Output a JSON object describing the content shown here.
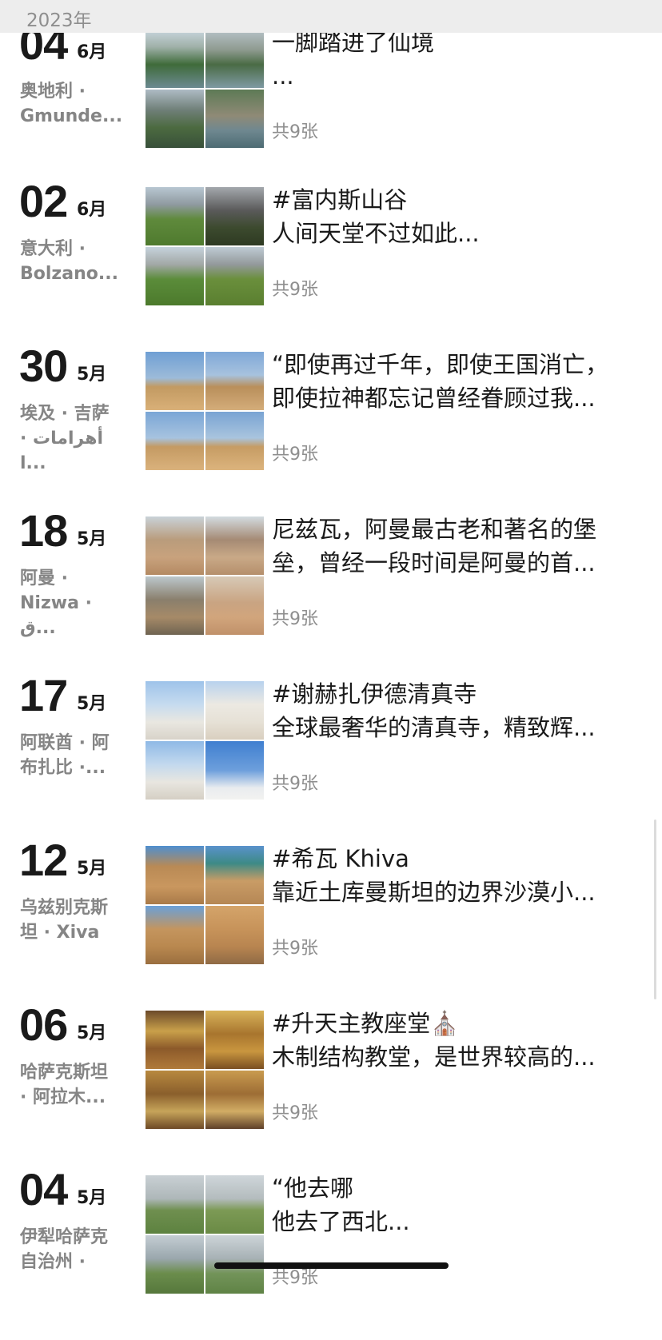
{
  "year_bar": {
    "label": "2023年"
  },
  "entries": [
    {
      "day": "04",
      "month": "6月",
      "location": "奥地利 ·\nGmunde...",
      "text_lines": [
        "一脚踏进了仙境",
        "..."
      ],
      "count": "共9张",
      "thumbs": [
        "mountain-lake",
        "mountain-lake",
        "mountain-village",
        "mountain-village"
      ]
    },
    {
      "day": "02",
      "month": "6月",
      "location": "意大利 ·\nBolzano...",
      "text_lines": [
        "#富内斯山谷",
        "人间天堂不过如此..."
      ],
      "count": "共9张",
      "thumbs": [
        "dolomites",
        "dolomites-dark",
        "dolomites-chapel",
        "dolomites-village"
      ]
    },
    {
      "day": "30",
      "month": "5月",
      "location": "埃及 · 吉萨\n· أهرامات ا...",
      "text_lines": [
        "“即使再过千年，即使王国消亡，",
        "即使拉神都忘记曾经眷顾过我..."
      ],
      "count": "共9张",
      "thumbs": [
        "pyramids",
        "sphinx",
        "pyramids",
        "pyramids"
      ]
    },
    {
      "day": "18",
      "month": "5月",
      "location": "阿曼 ·\nNizwa · ق...",
      "text_lines": [
        "尼兹瓦，阿曼最古老和著名的堡",
        "垒，曾经一段时间是阿曼的首..."
      ],
      "count": "共9张",
      "thumbs": [
        "fort-town",
        "mountain-desert",
        "town",
        "minaret"
      ]
    },
    {
      "day": "17",
      "month": "5月",
      "location": "阿联酋 · 阿\n布扎比 ·...",
      "text_lines": [
        "#谢赫扎伊德清真寺",
        "全球最奢华的清真寺，精致辉..."
      ],
      "count": "共9张",
      "thumbs": [
        "mosque",
        "mosque-dome",
        "mosque-minaret",
        "mosque-blue"
      ]
    },
    {
      "day": "12",
      "month": "5月",
      "location": "乌兹别克斯\n坦 · Xiva",
      "text_lines": [
        "#希瓦 Khiva",
        "靠近土库曼斯坦的边界沙漠小..."
      ],
      "count": "共9张",
      "thumbs": [
        "khiva-wall",
        "khiva-dome",
        "khiva-gate",
        "khiva-camel"
      ]
    },
    {
      "day": "06",
      "month": "5月",
      "location": "哈萨克斯坦\n· 阿拉木...",
      "text_lines": [
        "#升天主教座堂⛪",
        "木制结构教堂，是世界较高的..."
      ],
      "count": "共9张",
      "thumbs": [
        "church-gold",
        "church-gold",
        "church-interior",
        "church-interior"
      ]
    },
    {
      "day": "04",
      "month": "5月",
      "location": "伊犁哈萨克\n自治州 ·",
      "text_lines": [
        "“他去哪",
        "他去了西北..."
      ],
      "count": "共9张",
      "thumbs": [
        "grassland",
        "grassland-person",
        "grassland-mountain",
        "grassland"
      ]
    }
  ]
}
